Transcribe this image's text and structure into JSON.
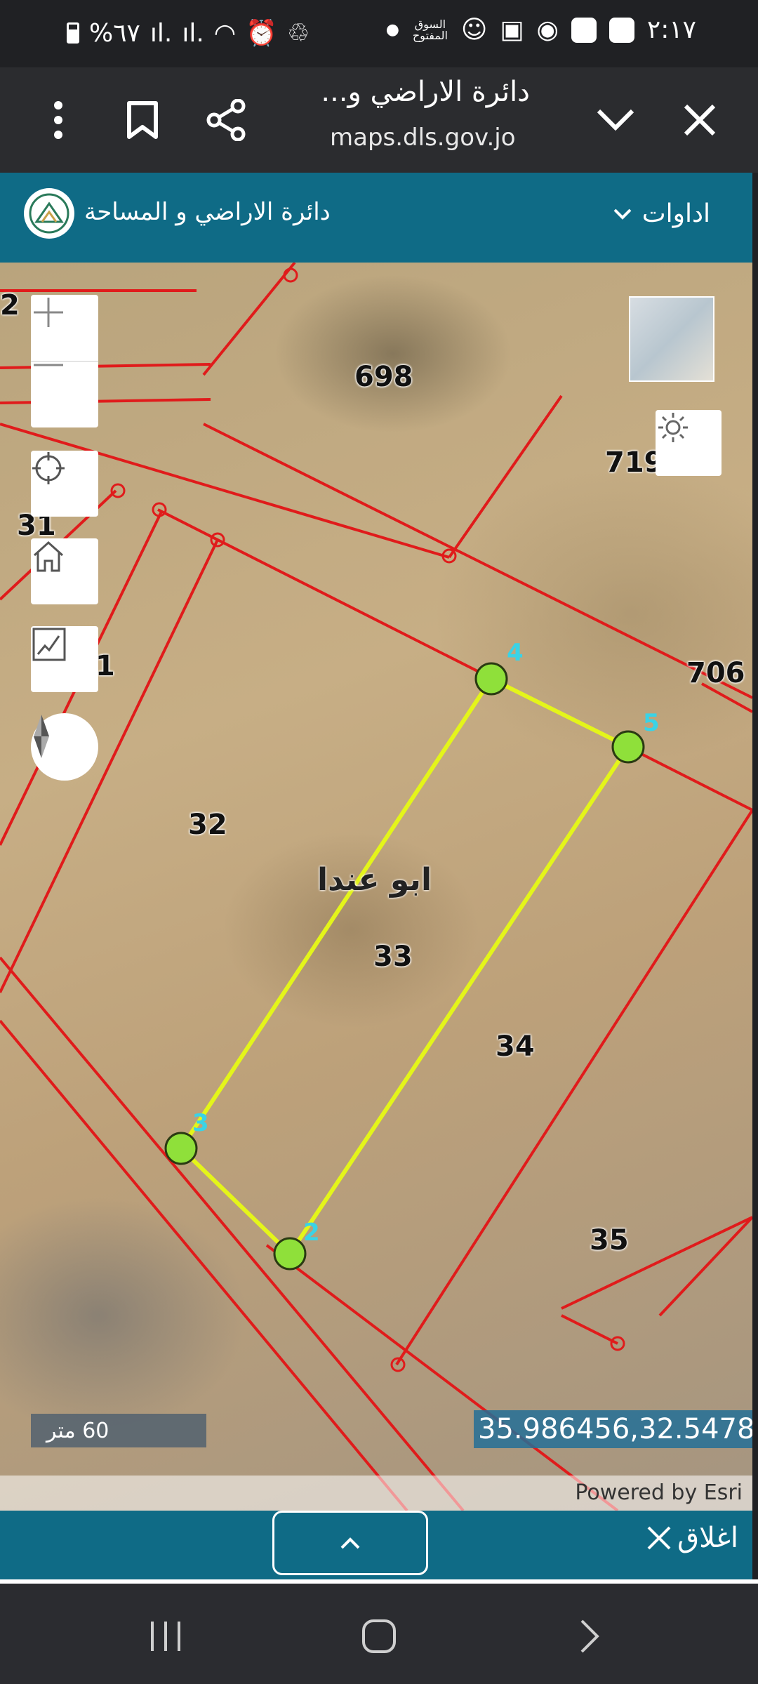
{
  "status_bar": {
    "time": "٢:١٧",
    "battery": "%٦٧",
    "store_label": "السوق المفتوح"
  },
  "browser": {
    "page_title": "دائرة الاراضي و...",
    "url": "maps.dls.gov.jo"
  },
  "site_header": {
    "brand_name": "دائرة الاراضي و المساحة",
    "tools_label": "اداوات"
  },
  "map": {
    "parcels": [
      {
        "number": "698"
      },
      {
        "number": "719"
      },
      {
        "number": "706"
      },
      {
        "number": "32"
      },
      {
        "number": "33"
      },
      {
        "number": "34"
      },
      {
        "number": "35"
      },
      {
        "number": "31"
      },
      {
        "number": "1"
      },
      {
        "number": "2"
      }
    ],
    "area_name": "ابو عندا",
    "vertices": [
      "2",
      "3",
      "4",
      "5"
    ],
    "scale_label": "60 متر",
    "coordinates": "35.986456,32.5478",
    "attribution": "Powered by Esri"
  },
  "bottom_panel": {
    "close_label": "اغلاق"
  },
  "colors": {
    "header": "#0f6b86",
    "parcel_line": "#e01b1b",
    "selection_line": "#e4f51a",
    "vertex": "#8fe03a"
  }
}
